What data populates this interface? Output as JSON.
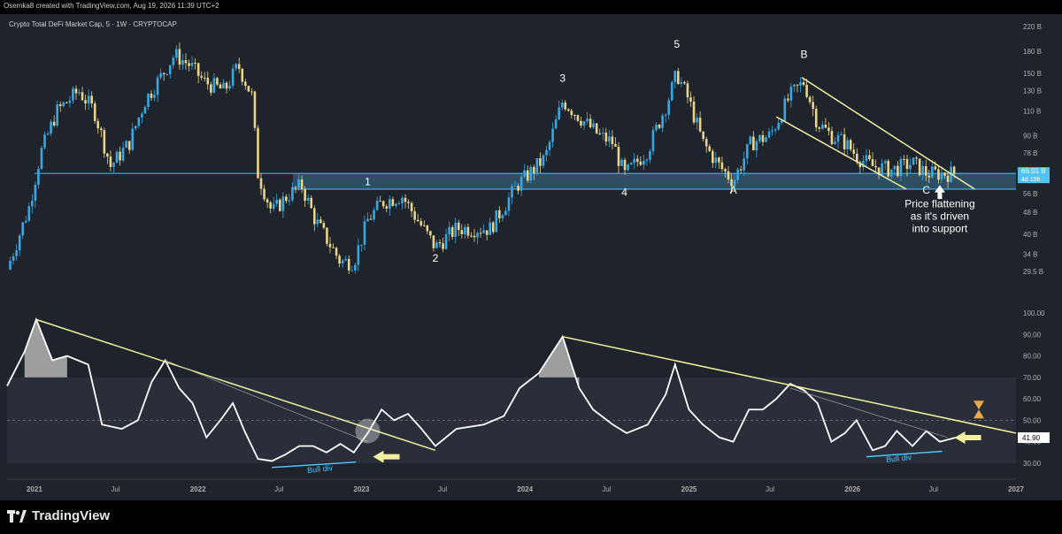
{
  "header": {
    "attribution": "Osemka8 created with TradingView.com, Aug 19, 2026 11:39 UTC+2"
  },
  "footer": {
    "brand": "TradingView"
  },
  "chart_data": [
    {
      "type": "candlestick",
      "title": "Crypto Total DeFi Market Cap, 5 · 1W · CRYPTOCAP",
      "ylabel": "",
      "y_scale": "log",
      "ylim": [
        25,
        230
      ],
      "y_ticks": [
        {
          "v": 220,
          "label": "220 B"
        },
        {
          "v": 180,
          "label": "180 B"
        },
        {
          "v": 150,
          "label": "150 B"
        },
        {
          "v": 130,
          "label": "130 B"
        },
        {
          "v": 110,
          "label": "110 B"
        },
        {
          "v": 90,
          "label": "90 B"
        },
        {
          "v": 78,
          "label": "78 B"
        },
        {
          "v": 56,
          "label": "56 B"
        },
        {
          "v": 48,
          "label": "48 B"
        },
        {
          "v": 40,
          "label": "40 B"
        },
        {
          "v": 34,
          "label": "34 B"
        },
        {
          "v": 29.5,
          "label": "29.5 B"
        }
      ],
      "last_price_label": "66.01 B",
      "countdown_label": "4d 15h",
      "close_path": [
        [
          "2020-11-01",
          30
        ],
        [
          "2020-12-20",
          50
        ],
        [
          "2021-01-15",
          78
        ],
        [
          "2021-02-20",
          110
        ],
        [
          "2021-04-10",
          130
        ],
        [
          "2021-05-15",
          110
        ],
        [
          "2021-06-20",
          70
        ],
        [
          "2021-08-01",
          85
        ],
        [
          "2021-09-05",
          120
        ],
        [
          "2021-10-15",
          150
        ],
        [
          "2021-11-10",
          175
        ],
        [
          "2021-12-15",
          160
        ],
        [
          "2022-01-15",
          140
        ],
        [
          "2022-03-01",
          130
        ],
        [
          "2022-04-01",
          160
        ],
        [
          "2022-05-01",
          125
        ],
        [
          "2022-05-15",
          66
        ],
        [
          "2022-06-15",
          48
        ],
        [
          "2022-07-20",
          55
        ],
        [
          "2022-08-20",
          60
        ],
        [
          "2022-09-20",
          45
        ],
        [
          "2022-11-15",
          32
        ],
        [
          "2022-12-15",
          32
        ],
        [
          "2023-01-15",
          45
        ],
        [
          "2023-02-15",
          52
        ],
        [
          "2023-04-01",
          55
        ],
        [
          "2023-06-15",
          36
        ],
        [
          "2023-08-01",
          42
        ],
        [
          "2023-10-15",
          42
        ],
        [
          "2023-12-15",
          60
        ],
        [
          "2024-02-15",
          75
        ],
        [
          "2024-03-25",
          120
        ],
        [
          "2024-05-15",
          100
        ],
        [
          "2024-06-15",
          90
        ],
        [
          "2024-07-15",
          85
        ],
        [
          "2024-08-10",
          65
        ],
        [
          "2024-10-01",
          80
        ],
        [
          "2024-11-15",
          120
        ],
        [
          "2024-12-05",
          150
        ],
        [
          "2025-01-01",
          120
        ],
        [
          "2025-02-01",
          85
        ],
        [
          "2025-03-10",
          70
        ],
        [
          "2025-04-10",
          62
        ],
        [
          "2025-05-20",
          85
        ],
        [
          "2025-07-01",
          90
        ],
        [
          "2025-08-15",
          125
        ],
        [
          "2025-09-15",
          140
        ],
        [
          "2025-10-15",
          100
        ],
        [
          "2025-11-15",
          90
        ],
        [
          "2025-12-15",
          85
        ],
        [
          "2026-01-15",
          75
        ],
        [
          "2026-02-15",
          70
        ],
        [
          "2026-04-01",
          68
        ],
        [
          "2026-05-15",
          72
        ],
        [
          "2026-06-15",
          66
        ],
        [
          "2026-07-15",
          66
        ],
        [
          "2026-08-19",
          66
        ]
      ],
      "support_zone": [
        58,
        66
      ],
      "wave_labels": [
        {
          "t": "1",
          "date": "2023-01-15",
          "v": 60
        },
        {
          "t": "2",
          "date": "2023-06-15",
          "v": 32
        },
        {
          "t": "3",
          "date": "2024-03-25",
          "v": 140
        },
        {
          "t": "4",
          "date": "2024-08-10",
          "v": 55
        },
        {
          "t": "5",
          "date": "2024-12-05",
          "v": 185
        },
        {
          "t": "A",
          "date": "2025-04-10",
          "v": 56
        },
        {
          "t": "B",
          "date": "2025-09-15",
          "v": 170
        },
        {
          "t": "C",
          "date": "2026-06-15",
          "v": 56
        }
      ],
      "annotation": [
        "Price flattening",
        "as it's driven",
        "into support"
      ]
    },
    {
      "type": "line",
      "name": "RSI",
      "ylim": [
        25,
        105
      ],
      "y_ticks": [
        {
          "v": 100,
          "label": "100.00"
        },
        {
          "v": 90,
          "label": "90.00"
        },
        {
          "v": 80,
          "label": "80.00"
        },
        {
          "v": 70,
          "label": "70.00"
        },
        {
          "v": 60,
          "label": "60.00"
        },
        {
          "v": 50,
          "label": "50.00"
        },
        {
          "v": 40,
          "label": "40.00"
        },
        {
          "v": 30,
          "label": "30.00"
        }
      ],
      "band": [
        30,
        70
      ],
      "mid": 50,
      "last_value_label": "41.90",
      "path": [
        [
          "2020-11-01",
          66
        ],
        [
          "2020-12-10",
          82
        ],
        [
          "2021-01-05",
          97
        ],
        [
          "2021-02-10",
          78
        ],
        [
          "2021-03-15",
          80
        ],
        [
          "2021-05-01",
          76
        ],
        [
          "2021-06-01",
          48
        ],
        [
          "2021-07-15",
          46
        ],
        [
          "2021-08-20",
          50
        ],
        [
          "2021-09-20",
          68
        ],
        [
          "2021-10-20",
          78
        ],
        [
          "2021-11-20",
          65
        ],
        [
          "2021-12-20",
          58
        ],
        [
          "2022-01-20",
          42
        ],
        [
          "2022-02-20",
          50
        ],
        [
          "2022-03-20",
          58
        ],
        [
          "2022-04-15",
          45
        ],
        [
          "2022-05-15",
          32
        ],
        [
          "2022-06-15",
          31
        ],
        [
          "2022-07-15",
          34
        ],
        [
          "2022-08-15",
          38
        ],
        [
          "2022-09-15",
          38
        ],
        [
          "2022-10-15",
          35
        ],
        [
          "2022-11-15",
          39
        ],
        [
          "2022-12-15",
          35
        ],
        [
          "2023-01-15",
          44
        ],
        [
          "2023-02-15",
          55
        ],
        [
          "2023-03-15",
          50
        ],
        [
          "2023-04-15",
          53
        ],
        [
          "2023-05-15",
          46
        ],
        [
          "2023-06-15",
          38
        ],
        [
          "2023-08-01",
          46
        ],
        [
          "2023-10-01",
          48
        ],
        [
          "2023-11-15",
          52
        ],
        [
          "2023-12-20",
          65
        ],
        [
          "2024-02-01",
          72
        ],
        [
          "2024-03-25",
          89
        ],
        [
          "2024-05-01",
          65
        ],
        [
          "2024-06-01",
          55
        ],
        [
          "2024-07-15",
          48
        ],
        [
          "2024-08-15",
          44
        ],
        [
          "2024-10-01",
          48
        ],
        [
          "2024-11-10",
          62
        ],
        [
          "2024-12-01",
          76
        ],
        [
          "2025-01-01",
          55
        ],
        [
          "2025-02-01",
          48
        ],
        [
          "2025-03-10",
          42
        ],
        [
          "2025-04-10",
          40
        ],
        [
          "2025-05-15",
          55
        ],
        [
          "2025-06-15",
          55
        ],
        [
          "2025-07-15",
          60
        ],
        [
          "2025-08-15",
          67
        ],
        [
          "2025-09-15",
          64
        ],
        [
          "2025-10-15",
          58
        ],
        [
          "2025-11-15",
          40
        ],
        [
          "2025-12-15",
          44
        ],
        [
          "2026-01-10",
          50
        ],
        [
          "2026-02-15",
          36
        ],
        [
          "2026-03-15",
          38
        ],
        [
          "2026-04-10",
          45
        ],
        [
          "2026-05-15",
          38
        ],
        [
          "2026-06-15",
          45
        ],
        [
          "2026-07-15",
          40
        ],
        [
          "2026-08-19",
          41.9
        ]
      ],
      "labels": [
        "Bull div",
        "Bull div"
      ]
    }
  ],
  "x_axis": {
    "ticks": [
      {
        "label": "2021",
        "date": "2021-01-01",
        "bold": true
      },
      {
        "label": "Jul",
        "date": "2021-07-01",
        "bold": false
      },
      {
        "label": "2022",
        "date": "2022-01-01",
        "bold": true
      },
      {
        "label": "Jul",
        "date": "2022-07-01",
        "bold": false
      },
      {
        "label": "2023",
        "date": "2023-01-01",
        "bold": true
      },
      {
        "label": "Jul",
        "date": "2023-07-01",
        "bold": false
      },
      {
        "label": "2024",
        "date": "2024-01-01",
        "bold": true
      },
      {
        "label": "Jul",
        "date": "2024-07-01",
        "bold": false
      },
      {
        "label": "2025",
        "date": "2025-01-01",
        "bold": true
      },
      {
        "label": "Jul",
        "date": "2025-07-01",
        "bold": false
      },
      {
        "label": "2026",
        "date": "2026-01-01",
        "bold": true
      },
      {
        "label": "Jul",
        "date": "2026-07-01",
        "bold": false
      },
      {
        "label": "2027",
        "date": "2027-01-01",
        "bold": true
      }
    ]
  },
  "colors": {
    "background": "#1f232b",
    "rsi_band": "#2a2e39",
    "up": "#3aa8e0",
    "down": "#e8d48b",
    "support": "#4fc3f7",
    "trendline": "#f5f0a0",
    "rsi_line": "#ffffff",
    "arrow": "#f5f0a0"
  }
}
